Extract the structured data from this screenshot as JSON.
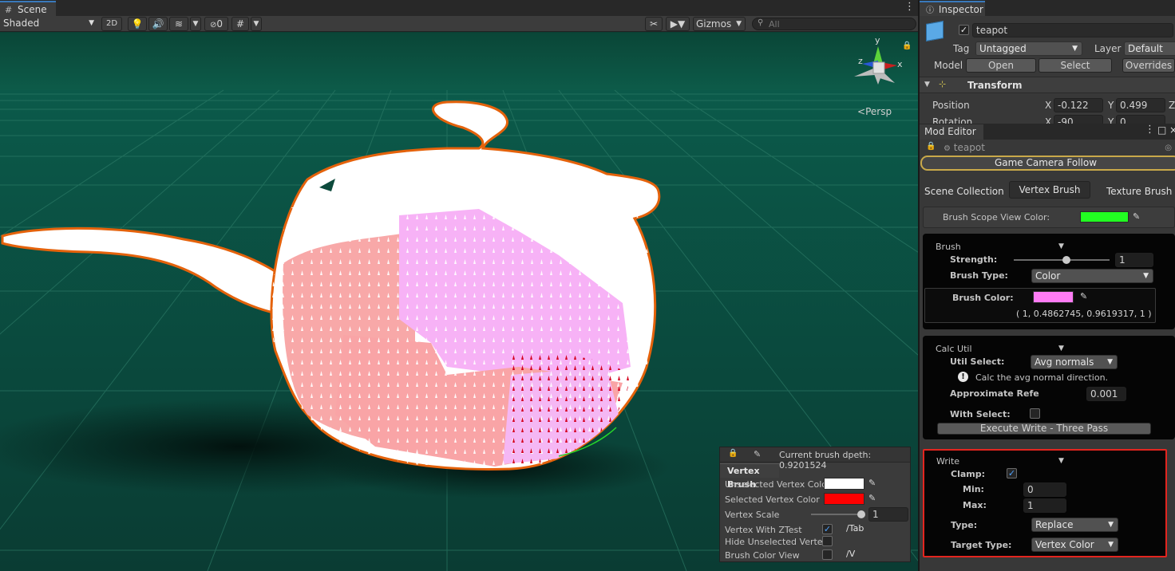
{
  "scene": {
    "tab_label": "Scene",
    "shading_mode": "Shaded",
    "btn_2d": "2D",
    "hidden_count": "0",
    "gizmos_label": "Gizmos",
    "search_placeholder": "All",
    "persp_label": "Persp",
    "axis_y": "y",
    "axis_x": "x",
    "axis_z": "z"
  },
  "inspector": {
    "tab_label": "Inspector",
    "object_name": "teapot",
    "tag_label": "Tag",
    "tag_value": "Untagged",
    "layer_label": "Layer",
    "layer_value": "Default",
    "model_label": "Model",
    "open_btn": "Open",
    "select_btn": "Select",
    "overrides_btn": "Overrides",
    "transform_title": "Transform",
    "position_label": "Position",
    "pos_x_label": "X",
    "pos_x": "-0.122",
    "pos_y_label": "Y",
    "pos_y": "0.499",
    "pos_z_label": "Z",
    "rotation_label": "Rotation",
    "rot_x_label": "X",
    "rot_x": "-90",
    "rot_y_label": "Y",
    "rot_y": "0"
  },
  "mod_editor": {
    "tab_label": "Mod Editor",
    "target_object": "teapot",
    "camera_follow_btn": "Game Camera Follow",
    "tabs": [
      "Scene Collection",
      "Vertex Brush",
      "Texture Brush"
    ],
    "scope_color_label": "Brush Scope View Color:",
    "scope_color": "#22ff22",
    "brush": {
      "title": "Brush",
      "strength_label": "Strength:",
      "strength_value": "1",
      "strength_fraction": 0.55,
      "type_label": "Brush Type:",
      "type_value": "Color",
      "color_label": "Brush Color:",
      "color_swatch": "#ff7cf5",
      "color_values": "( 1, 0.4862745, 0.9619317, 1 )"
    },
    "calc": {
      "title": "Calc Util",
      "util_label": "Util Select:",
      "util_value": "Avg normals",
      "info_text": "Calc the avg normal direction.",
      "approx_label": "Approximate Refe",
      "approx_value": "0.001",
      "with_select_label": "With Select:",
      "execute_btn": "Execute Write - Three Pass"
    },
    "write": {
      "title": "Write",
      "clamp_label": "Clamp:",
      "min_label": "Min:",
      "min_value": "0",
      "max_label": "Max:",
      "max_value": "1",
      "type_label": "Type:",
      "type_value": "Replace",
      "target_label": "Target Type:",
      "target_value": "Vertex Color"
    }
  },
  "overlay": {
    "depth_text": "Current brush dpeth:  0.9201524",
    "title": "Vertex Brush",
    "unselected_label": "Unselected Vertex Color",
    "unselected_color": "#ffffff",
    "selected_label": "Selected Vertex Color",
    "selected_color": "#ff0000",
    "scale_label": "Vertex Scale",
    "scale_value": "1",
    "ztest_label": "Vertex With ZTest",
    "ztest_shortcut": "/Tab",
    "hide_label": "Hide Unselected Vertex",
    "color_view_label": "Brush Color View",
    "color_view_shortcut": "/V"
  }
}
